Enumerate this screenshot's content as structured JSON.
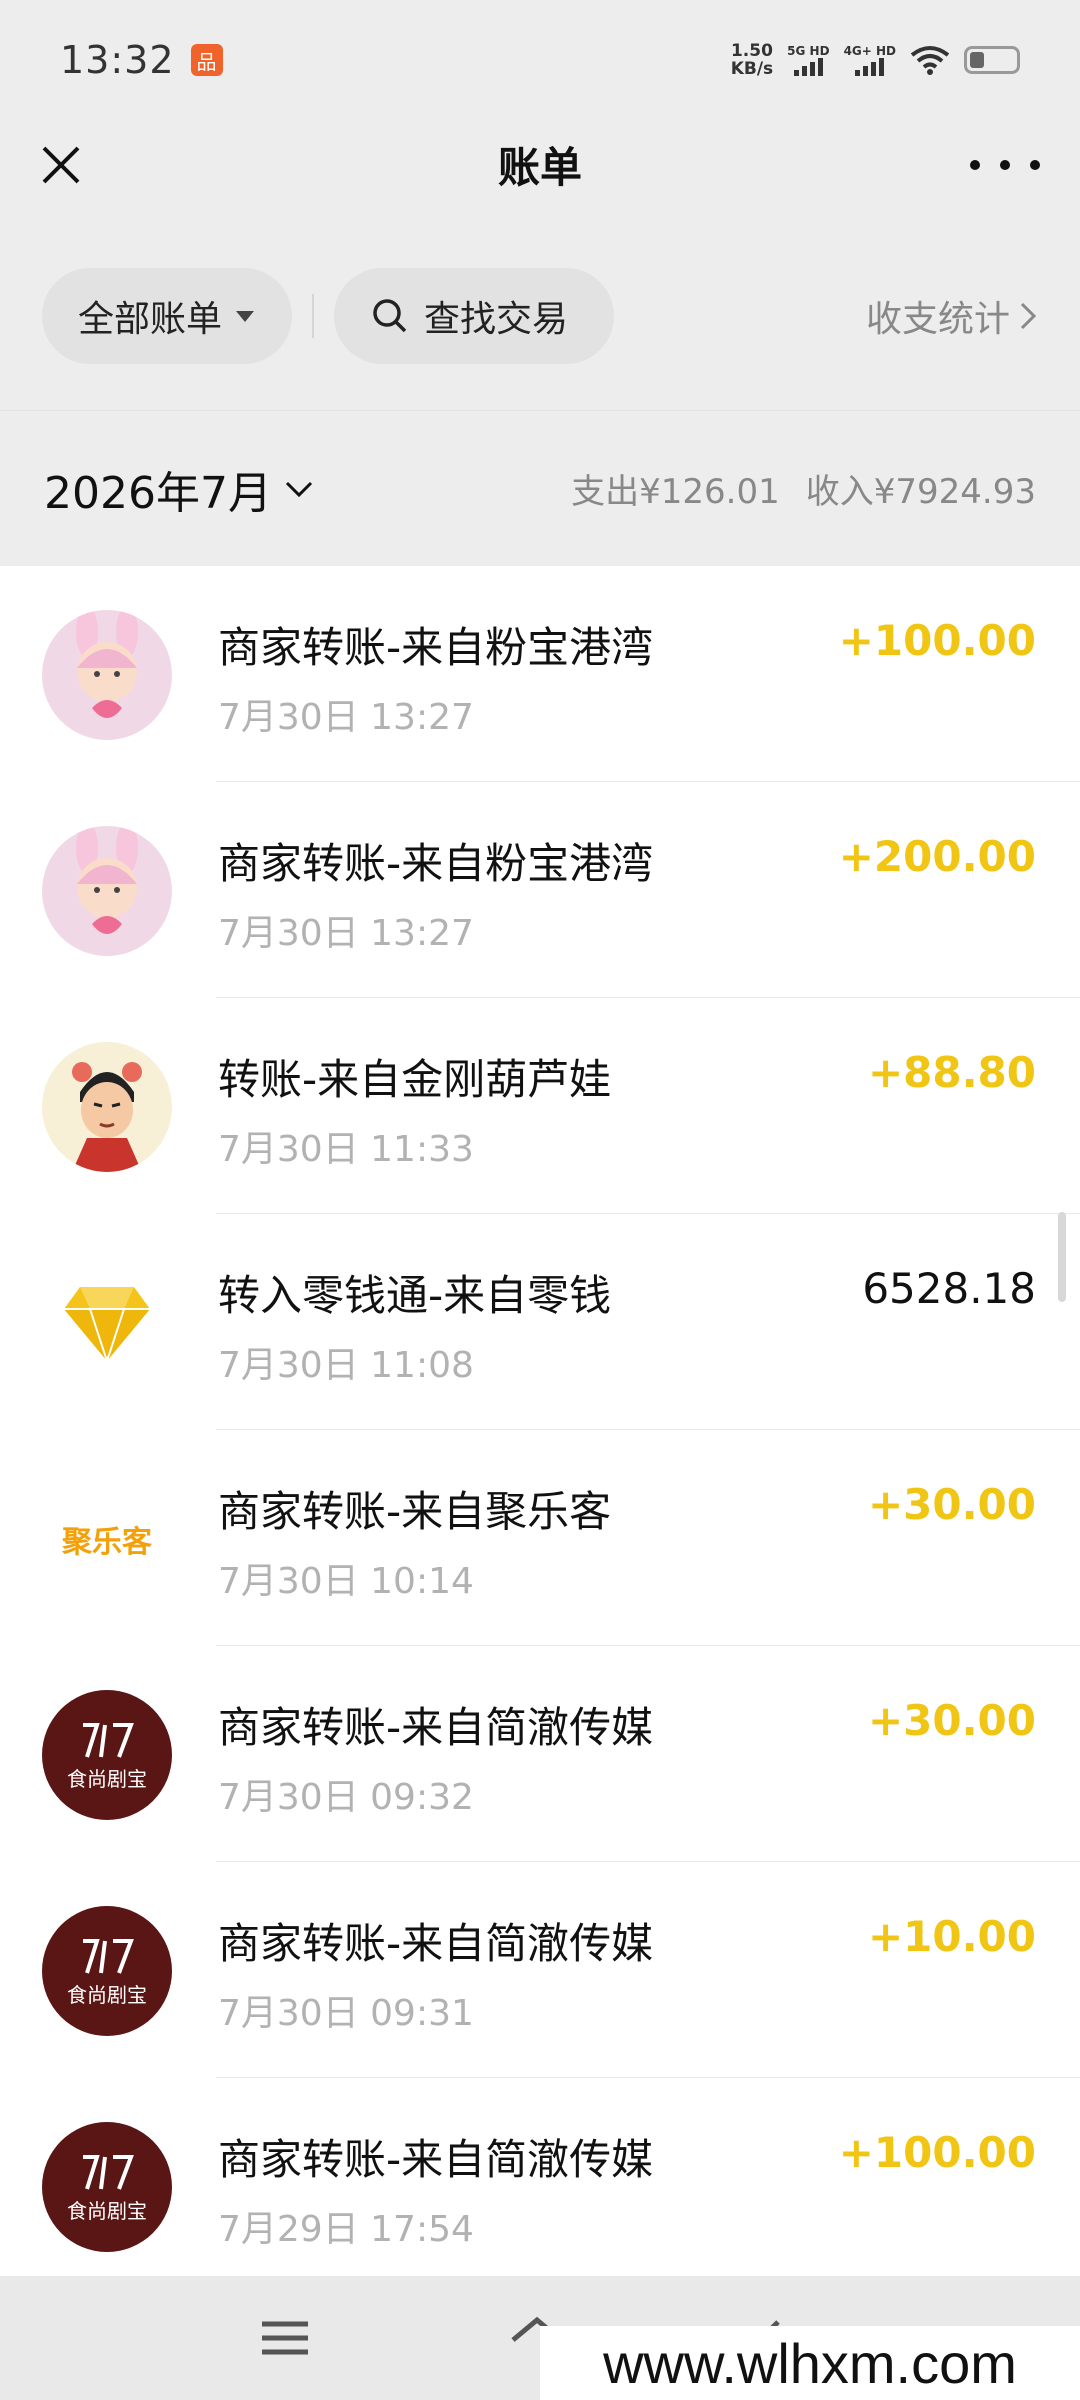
{
  "status_bar": {
    "time": "13:32",
    "net_speed_value": "1.50",
    "net_speed_unit": "KB/s",
    "sim1_label": "5G HD",
    "sim2_label": "4G+ HD",
    "app_badge_glyph": "品"
  },
  "header": {
    "title": "账单",
    "close_icon": "close-icon",
    "more_icon": "more-icon"
  },
  "filters": {
    "all_bills_label": "全部账单",
    "search_label": "查找交易",
    "stats_label": "收支统计"
  },
  "month_summary": {
    "month": "2026年7月",
    "expense": "支出¥126.01",
    "income": "收入¥7924.93"
  },
  "transactions": [
    {
      "name": "商家转账-来自粉宝港湾",
      "date": "7月30日 13:27",
      "amount": "+100.00",
      "avatar": "pink-bunny-avatar"
    },
    {
      "name": "商家转账-来自粉宝港湾",
      "date": "7月30日 13:27",
      "amount": "+200.00",
      "avatar": "pink-bunny-avatar"
    },
    {
      "name": "转账-来自金刚葫芦娃",
      "date": "7月30日 11:33",
      "amount": "+88.80",
      "avatar": "calabash-boy-avatar"
    },
    {
      "name": "转入零钱通-来自零钱",
      "date": "7月30日 11:08",
      "amount": "6528.18",
      "avatar": "diamond-icon"
    },
    {
      "name": "商家转账-来自聚乐客",
      "date": "7月30日 10:14",
      "amount": "+30.00",
      "avatar": "julek-logo",
      "avatar_text": "聚乐客"
    },
    {
      "name": "商家转账-来自简澈传媒",
      "date": "7月30日 09:32",
      "amount": "+30.00",
      "avatar": "dream-born-logo",
      "avatar_text": "食尚剧宝"
    },
    {
      "name": "商家转账-来自简澈传媒",
      "date": "7月30日 09:31",
      "amount": "+10.00",
      "avatar": "dream-born-logo",
      "avatar_text": "食尚剧宝"
    },
    {
      "name": "商家转账-来自简澈传媒",
      "date": "7月29日 17:54",
      "amount": "+100.00",
      "avatar": "dream-born-logo",
      "avatar_text": "食尚剧宝"
    }
  ],
  "colors": {
    "income_amount": "#f0c514",
    "page_background": "#ededed",
    "list_background": "#ffffff",
    "date_text": "#b2b2b2"
  },
  "nav_bar": {
    "menu_icon": "menu-icon",
    "home_icon": "home-icon",
    "back_icon": "back-icon"
  },
  "watermark": "www.wlhxm.com"
}
